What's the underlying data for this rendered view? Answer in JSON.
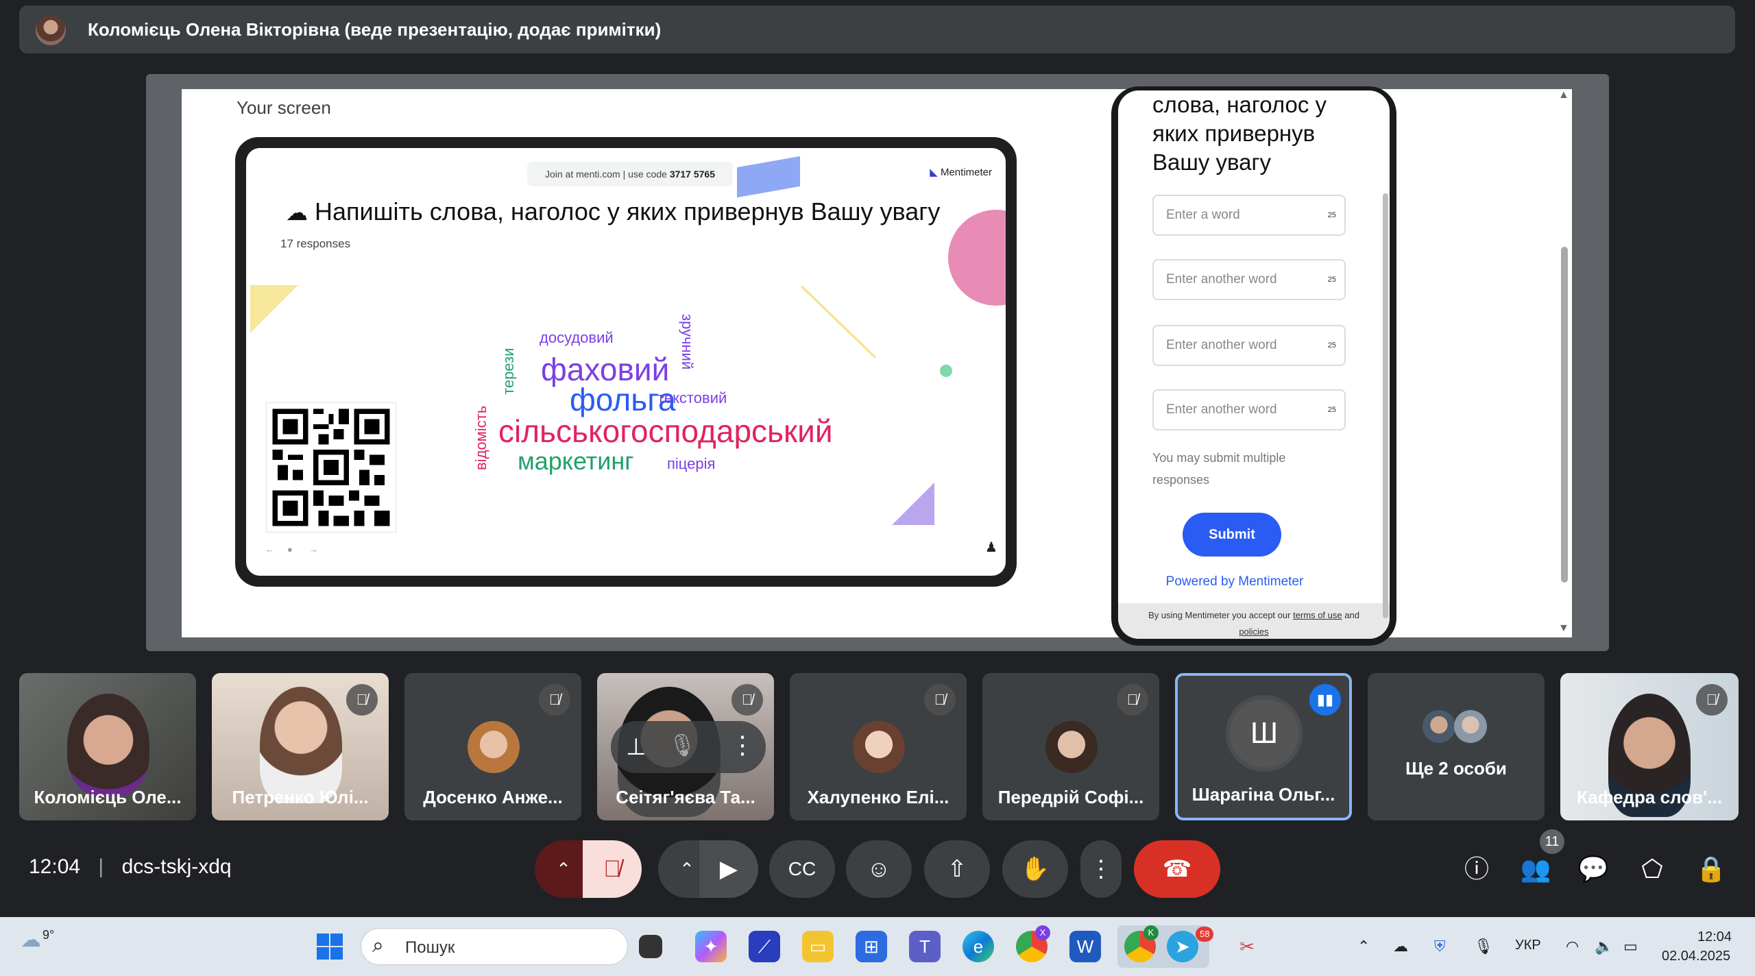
{
  "presenter_banner": {
    "text": "Коломієць Олена Вікторівна (веде презентацію, додає примітки)"
  },
  "presentation": {
    "label": "Your screen",
    "slide": {
      "join_text": "Join at menti.com | use code",
      "code": "3717 5765",
      "brand": "Mentimeter",
      "title": "Напишіть слова, наголос у яких привернув Вашу увагу",
      "responses": "17 responses",
      "words": [
        {
          "text": "досудовий",
          "color": "#7b3fe4"
        },
        {
          "text": "фаховий",
          "color": "#7b3fe4"
        },
        {
          "text": "фольга",
          "color": "#2a5cf3"
        },
        {
          "text": "текстовий",
          "color": "#7b3fe4"
        },
        {
          "text": "терези",
          "color": "#22a06b"
        },
        {
          "text": "зручний",
          "color": "#7b3fe4"
        },
        {
          "text": "відомість",
          "color": "#e0245e"
        },
        {
          "text": "сільськогосподарський",
          "color": "#e0245e"
        },
        {
          "text": "маркетинг",
          "color": "#22a06b"
        },
        {
          "text": "піцерія",
          "color": "#7b3fe4"
        }
      ]
    },
    "phone": {
      "title": "слова, наголос у яких привернув Вашу увагу",
      "inputs": [
        {
          "placeholder": "Enter a word",
          "count": "25"
        },
        {
          "placeholder": "Enter another word",
          "count": "25"
        },
        {
          "placeholder": "Enter another word",
          "count": "25"
        },
        {
          "placeholder": "Enter another word",
          "count": "25"
        }
      ],
      "note": "You may submit multiple responses",
      "submit": "Submit",
      "powered": "Powered by Mentimeter",
      "footer_pre": "By using Mentimeter you accept our",
      "footer_terms": "terms of use",
      "footer_and": "and",
      "footer_policies": "policies"
    }
  },
  "participants": [
    {
      "name": "Коломієць Оле...",
      "muted": false,
      "video": true
    },
    {
      "name": "Петренко Юлі...",
      "muted": true,
      "video": true
    },
    {
      "name": "Досенко Анже...",
      "muted": true,
      "video": false
    },
    {
      "name": "Сеітяг'яєва Та...",
      "muted": true,
      "video": true
    },
    {
      "name": "Халупенко Елі...",
      "muted": true,
      "video": false
    },
    {
      "name": "Передрій Софі...",
      "muted": true,
      "video": false
    },
    {
      "name": "Шарагіна Ольг...",
      "initial": "Ш",
      "speaking": true
    },
    {
      "name": "Ще 2 особи"
    },
    {
      "name": "Кафедра слов'...",
      "muted": true,
      "video": true
    }
  ],
  "meeting": {
    "time": "12:04",
    "separator": "|",
    "code": "dcs-tskj-xdq",
    "people_count": "11"
  },
  "taskbar": {
    "weather": "9°",
    "search_placeholder": "Пошук",
    "language": "УКР",
    "clock_time": "12:04",
    "clock_date": "02.04.2025",
    "badge_chrome1": "X",
    "badge_chrome2": "K",
    "badge_telegram": "58"
  }
}
